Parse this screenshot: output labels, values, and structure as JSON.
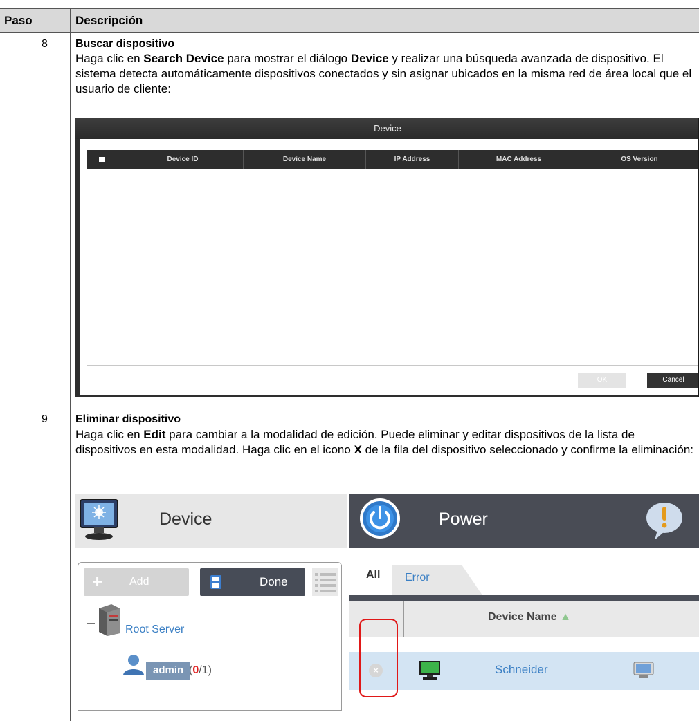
{
  "table": {
    "header": {
      "paso": "Paso",
      "descripcion": "Descripción"
    }
  },
  "steps": [
    {
      "number": "8",
      "title": "Buscar dispositivo",
      "text_parts": [
        "Haga clic en ",
        "Search Device",
        " para mostrar el diálogo ",
        "Device",
        " y realizar una búsqueda avanzada de dispositivo. El sistema detecta automáticamente dispositivos conectados y sin asignar ubicados en la misma red de área local que el usuario de cliente:"
      ]
    },
    {
      "number": "9",
      "title": "Eliminar dispositivo",
      "text_parts": [
        "Haga clic en ",
        "Edit",
        " para cambiar a la modalidad de edición. Puede eliminar y editar dispositivos de la lista de dispositivos en esta modalidad. Haga clic en el icono ",
        "X",
        " de la fila del dispositivo seleccionado y confirme la eliminación:"
      ]
    }
  ],
  "search_dialog": {
    "title": "Device",
    "columns": [
      "Device ID",
      "Device Name",
      "IP Address",
      "MAC Address",
      "OS Version"
    ],
    "ok_label": "OK",
    "cancel_label": "Cancel"
  },
  "device_manager": {
    "device_title": "Device",
    "power_title": "Power",
    "add_label": "Add",
    "done_label": "Done",
    "root_server": "Root Server",
    "admin_label": "admin",
    "admin_count_open": "(",
    "admin_count_active": "0",
    "admin_count_total": "/1)",
    "tabs": {
      "all": "All",
      "error": "Error"
    },
    "column_device_name": "Device Name",
    "sort_indicator": "▲",
    "row_device_name": "Schneider",
    "delete_glyph": "×"
  },
  "colors": {
    "header_bg": "#d9d9d9",
    "link_blue": "#3a7fc4",
    "row_selected": "#d3e4f3",
    "dark_bar": "#494c55",
    "highlight_red": "#e01818",
    "count_red": "#e02020"
  },
  "icons": [
    "monitor-icon",
    "power-icon",
    "alert-icon",
    "disk-icon",
    "list-icon",
    "server-icon",
    "user-icon",
    "pc-icon",
    "device-icon",
    "delete-icon"
  ]
}
